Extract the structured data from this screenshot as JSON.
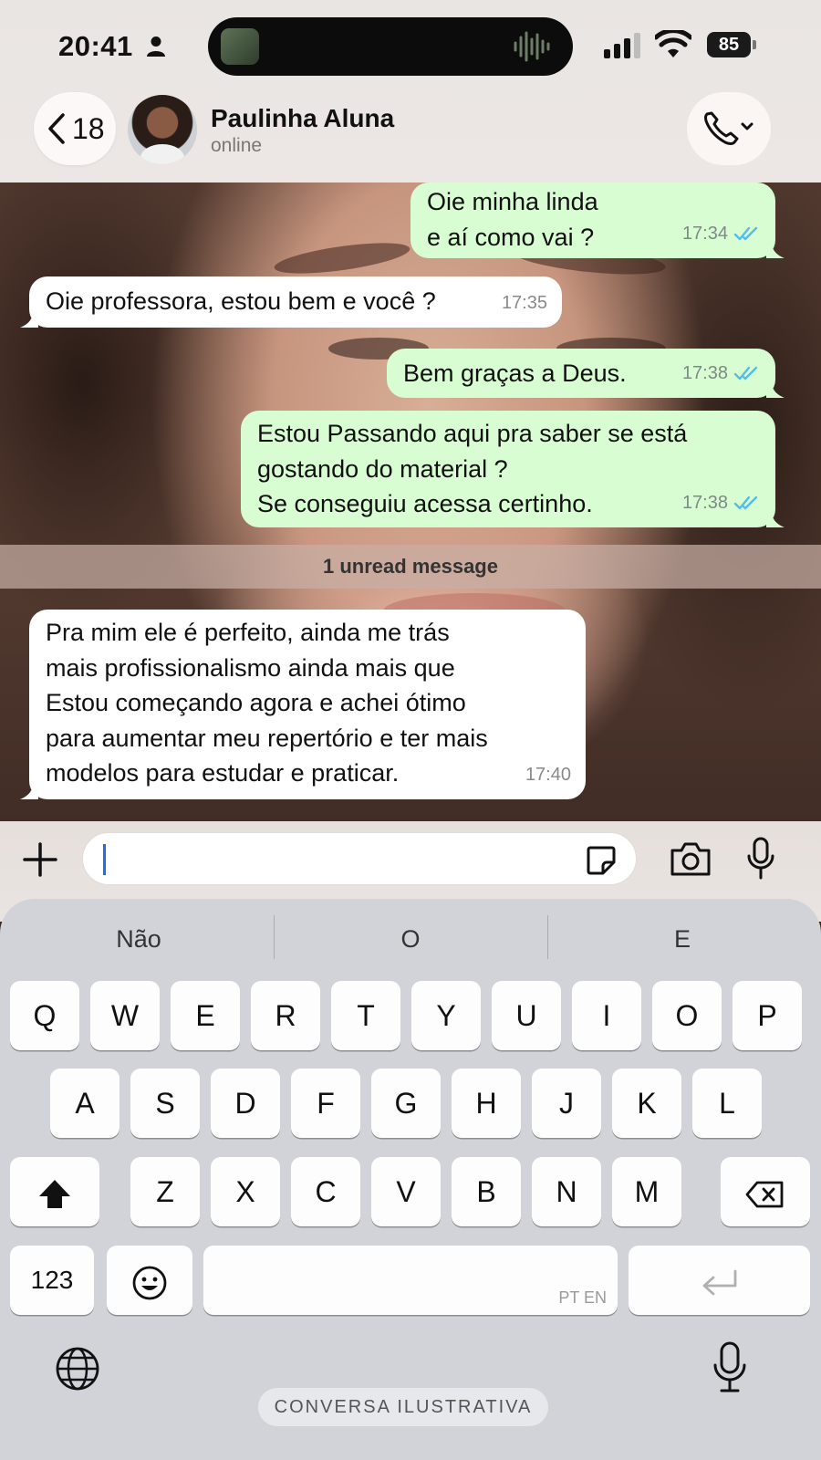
{
  "status_bar": {
    "time": "20:41",
    "battery": "85",
    "icons": [
      "person-icon",
      "signal-icon",
      "wifi-icon",
      "battery-icon"
    ]
  },
  "header": {
    "back_count": "18",
    "contact_name": "Paulinha Aluna",
    "contact_status": "online",
    "icons": [
      "chevron-left-icon",
      "phone-icon",
      "chevron-down-icon"
    ]
  },
  "messages": [
    {
      "dir": "out",
      "text": "Oie minha linda\ne aí como vai ?",
      "time": "17:34",
      "read": true
    },
    {
      "dir": "in",
      "text": "Oie professora, estou bem e você ?",
      "time": "17:35"
    },
    {
      "dir": "out",
      "text": "Bem graças a Deus.",
      "time": "17:38",
      "read": true
    },
    {
      "dir": "out",
      "text": "Estou Passando aqui pra saber se está\ngostando do material ?\nSe conseguiu acessa certinho.",
      "time": "17:38",
      "read": true
    },
    {
      "dir": "in",
      "text": "Pra mim ele é perfeito, ainda me trás\nmais profissionalismo ainda mais que\nEstou começando agora e achei ótimo\npara aumentar meu repertório e ter mais\nmodelos para estudar e praticar.",
      "time": "17:40"
    }
  ],
  "unread_banner": "1 unread message",
  "composer": {
    "input_value": "",
    "icons": [
      "plus-icon",
      "sticker-icon",
      "camera-icon",
      "mic-icon"
    ]
  },
  "keyboard": {
    "suggestions": [
      "Não",
      "O",
      "E"
    ],
    "row1": [
      "Q",
      "W",
      "E",
      "R",
      "T",
      "Y",
      "U",
      "I",
      "O",
      "P"
    ],
    "row2": [
      "A",
      "S",
      "D",
      "F",
      "G",
      "H",
      "J",
      "K",
      "L"
    ],
    "row3": [
      "Z",
      "X",
      "C",
      "V",
      "B",
      "N",
      "M"
    ],
    "numbers_key": "123",
    "space_hint": "PT EN",
    "icons": [
      "shift-icon",
      "backspace-icon",
      "emoji-icon",
      "return-icon",
      "globe-icon",
      "dictation-mic-icon"
    ]
  },
  "watermark": "CONVERSA ILUSTRATIVA",
  "colors": {
    "outgoing_bubble": "#d9fdd2",
    "incoming_bubble": "#ffffff",
    "read_ticks": "#53bdeb",
    "caret": "#1d6cf2"
  }
}
